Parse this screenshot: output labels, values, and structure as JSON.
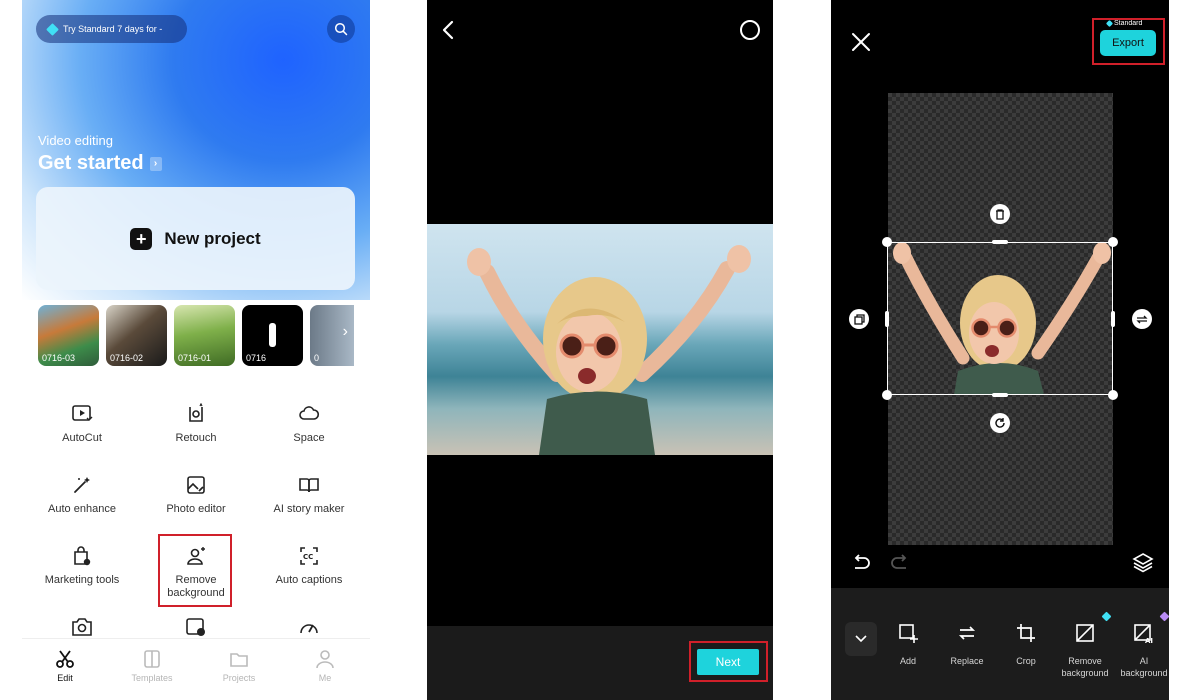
{
  "screen1": {
    "trial_text": "Try Standard 7 days for -",
    "section_subtitle": "Video editing",
    "section_title": "Get started",
    "new_project_label": "New project",
    "recent_projects": [
      {
        "label": "0716-03"
      },
      {
        "label": "0716-02"
      },
      {
        "label": "0716-01"
      },
      {
        "label": "0716"
      },
      {
        "label": "0"
      }
    ],
    "tools": [
      {
        "label": "AutoCut",
        "icon": "autocut-icon"
      },
      {
        "label": "Retouch",
        "icon": "retouch-icon"
      },
      {
        "label": "Space",
        "icon": "cloud-icon"
      },
      {
        "label": "Auto enhance",
        "icon": "magic-wand-icon"
      },
      {
        "label": "Photo editor",
        "icon": "photo-edit-icon"
      },
      {
        "label": "AI story maker",
        "icon": "book-icon"
      },
      {
        "label": "Marketing tools",
        "icon": "shopping-bag-icon"
      },
      {
        "label": "Remove background",
        "icon": "person-sparkle-icon"
      },
      {
        "label": "Auto captions",
        "icon": "captions-icon"
      }
    ],
    "bottom_nav": [
      {
        "label": "Edit",
        "icon": "scissors-icon",
        "active": true
      },
      {
        "label": "Templates",
        "icon": "templates-icon",
        "active": false
      },
      {
        "label": "Projects",
        "icon": "folder-icon",
        "active": false
      },
      {
        "label": "Me",
        "icon": "person-icon",
        "active": false
      }
    ]
  },
  "screen2": {
    "next_label": "Next"
  },
  "screen3": {
    "standard_label": "Standard",
    "export_label": "Export",
    "toolbar": [
      {
        "label": "Add",
        "icon": "add-layer-icon"
      },
      {
        "label": "Replace",
        "icon": "replace-icon"
      },
      {
        "label": "Crop",
        "icon": "crop-icon"
      },
      {
        "label": "Remove background",
        "icon": "remove-background-icon"
      },
      {
        "label": "AI background",
        "icon": "ai-background-icon"
      }
    ]
  },
  "colors": {
    "accent": "#1ED3DC",
    "highlight_box": "#D0202A",
    "premium_diamond_cyan": "#40E0F5",
    "premium_diamond_purple": "#B98CF5"
  }
}
